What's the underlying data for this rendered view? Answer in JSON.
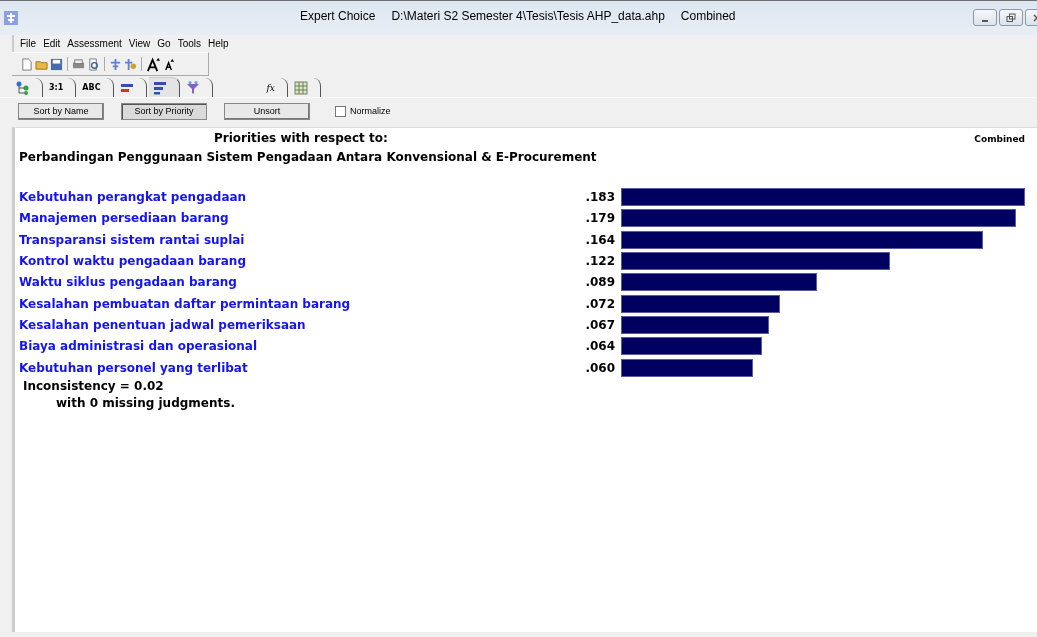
{
  "window": {
    "title": "Expert Choice",
    "file_path": "D:\\Materi S2 Semester 4\\Tesis\\Tesis AHP_data.ahp",
    "mode": "Combined"
  },
  "menu": [
    "File",
    "Edit",
    "Assessment",
    "View",
    "Go",
    "Tools",
    "Help"
  ],
  "tabs": [
    {
      "kind": "tree",
      "selected": false
    },
    {
      "kind": "text",
      "label": "3:1",
      "selected": false
    },
    {
      "kind": "text",
      "label": "ABC",
      "selected": false
    },
    {
      "kind": "bar",
      "selected": false
    },
    {
      "kind": "bars",
      "selected": true
    },
    {
      "kind": "funnel",
      "selected": false
    },
    {
      "kind": "fx",
      "label": "fx",
      "selected": false
    },
    {
      "kind": "grid",
      "selected": false
    }
  ],
  "sort_buttons": [
    {
      "label": "Sort by Name",
      "selected": false
    },
    {
      "label": "Sort by Priority",
      "selected": true
    },
    {
      "label": "Unsort",
      "selected": false
    }
  ],
  "normalize": {
    "label": "Normalize",
    "checked": false
  },
  "report": {
    "heading": "Priorities with respect to:",
    "goal": "Perbandingan Penggunaan Sistem Pengadaan Antara Konvensional & E-Procurement",
    "mode_label": "Combined",
    "items": [
      {
        "name": "Kebutuhan perangkat pengadaan",
        "value": ".183"
      },
      {
        "name": "Manajemen persediaan barang",
        "value": ".179"
      },
      {
        "name": "Transparansi sistem rantai suplai",
        "value": ".164"
      },
      {
        "name": "Kontrol waktu pengadaan barang",
        "value": ".122"
      },
      {
        "name": "Waktu siklus pengadaan barang",
        "value": ".089"
      },
      {
        "name": "Kesalahan pembuatan daftar permintaan barang",
        "value": ".072"
      },
      {
        "name": "Kesalahan penentuan jadwal pemeriksaan",
        "value": ".067"
      },
      {
        "name": "Biaya administrasi dan operasional",
        "value": ".064"
      },
      {
        "name": "Kebutuhan personel yang terlibat",
        "value": ".060"
      }
    ],
    "inconsistency": "Inconsistency = 0.02",
    "missing": "with 0  missing judgments."
  }
}
